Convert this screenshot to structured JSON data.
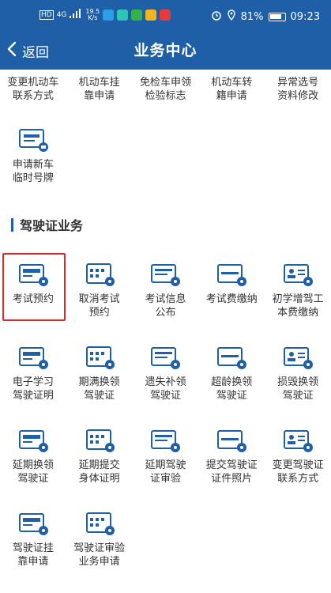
{
  "status_bar": {
    "signal": "4G",
    "net_speed_top": "19.5",
    "net_speed_bottom": "K/s",
    "battery": "81%",
    "time": "09:23"
  },
  "nav": {
    "back_label": "返回",
    "title": "业务中心"
  },
  "top_items": [
    {
      "line1": "变更机动车",
      "line2": "联系方式"
    },
    {
      "line1": "机动车挂",
      "line2": "靠申请"
    },
    {
      "line1": "免检车申领",
      "line2": "检验标志"
    },
    {
      "line1": "机动车转",
      "line2": "籍申请"
    },
    {
      "line1": "异常选号",
      "line2": "资料修改"
    }
  ],
  "temp_plate": {
    "line1": "申请新车",
    "line2": "临时号牌"
  },
  "section": {
    "title": "驾驶证业务"
  },
  "license_items": [
    {
      "line1": "考试预约",
      "line2": ""
    },
    {
      "line1": "取消考试",
      "line2": "预约"
    },
    {
      "line1": "考试信息",
      "line2": "公布"
    },
    {
      "line1": "考试费缴纳",
      "line2": ""
    },
    {
      "line1": "初学增驾工",
      "line2": "本费缴纳"
    },
    {
      "line1": "电子学习",
      "line2": "驾驶证明"
    },
    {
      "line1": "期满换领",
      "line2": "驾驶证"
    },
    {
      "line1": "遗失补领",
      "line2": "驾驶证"
    },
    {
      "line1": "超龄换领",
      "line2": "驾驶证"
    },
    {
      "line1": "损毁换领",
      "line2": "驾驶证"
    },
    {
      "line1": "延期换领",
      "line2": "驾驶证"
    },
    {
      "line1": "延期提交",
      "line2": "身体证明"
    },
    {
      "line1": "延期驾驶",
      "line2": "证审验"
    },
    {
      "line1": "提交驾驶证",
      "line2": "证件照片"
    },
    {
      "line1": "变更驾驶证",
      "line2": "联系方式"
    },
    {
      "line1": "驾驶证挂",
      "line2": "靠申请"
    },
    {
      "line1": "驾驶证审验",
      "line2": "业务申请"
    }
  ],
  "colors": {
    "primary": "#1f5fa8",
    "highlight": "#e0262a"
  }
}
